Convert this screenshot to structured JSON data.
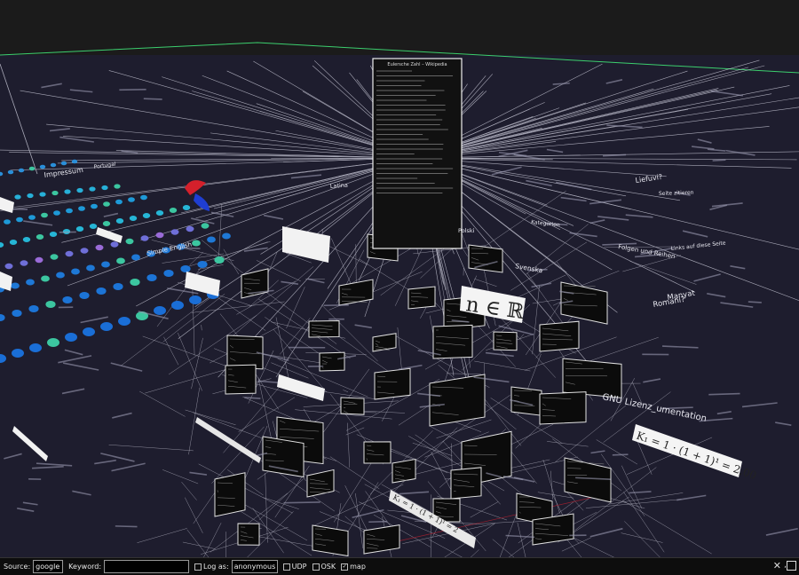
{
  "scene": {
    "doc_title": "Eulersche Zahl – Wikipedia",
    "formulas": {
      "n_in_r": "n ∈ ℝ",
      "k_eq": "K₁ = 1 · (1 + 1)¹ = 2,00",
      "k_eq_small": "K₁ = 1 · (1 + 1)¹ = 2"
    },
    "labels": [
      "Impressum",
      "Portugal",
      "Latina",
      "Polski",
      "Svenska",
      "Kategorien",
      "Folgen und Reihen",
      "Liefuvi?",
      "Simple English",
      "Manyat",
      "Romani?",
      "GNU Lizenz_umentation",
      "Kategorie",
      "Seite zitieren",
      "Links auf diese Seite",
      "Tongasse",
      "Eulersche Zahl"
    ]
  },
  "bottombar": {
    "source_label": "Source:",
    "source_value": "google",
    "keyword_label": "Keyword:",
    "keyword_value": "",
    "logas_label": "Log as:",
    "logas_value": "anonymous",
    "udp_label": "UDP",
    "osk_label": "OSK",
    "map_label": "map",
    "map_checked": "✓",
    "close_symbol": "✕",
    "comma": ","
  }
}
